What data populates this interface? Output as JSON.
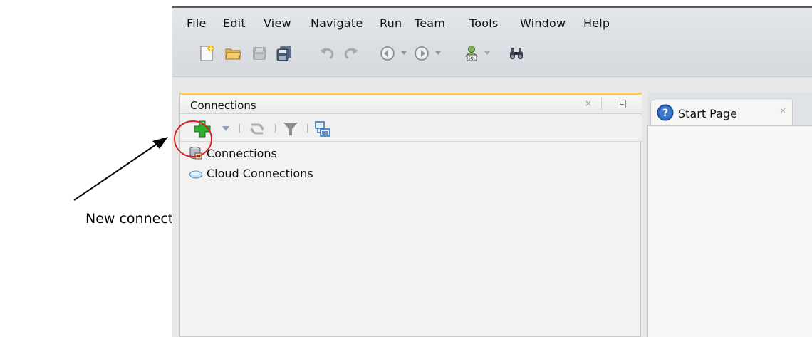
{
  "menubar": {
    "items": [
      {
        "pre": "",
        "u": "F",
        "post": "ile"
      },
      {
        "pre": "",
        "u": "E",
        "post": "dit"
      },
      {
        "pre": "",
        "u": "V",
        "post": "iew"
      },
      {
        "pre": "",
        "u": "N",
        "post": "avigate"
      },
      {
        "pre": "",
        "u": "R",
        "post": "un"
      },
      {
        "pre": "Tea",
        "u": "m",
        "post": ""
      },
      {
        "pre": "",
        "u": "T",
        "post": "ools"
      },
      {
        "pre": "",
        "u": "W",
        "post": "indow"
      },
      {
        "pre": "",
        "u": "H",
        "post": "elp"
      }
    ]
  },
  "toolbar": {
    "icons": [
      "new-file-icon",
      "open-folder-icon",
      "save-icon",
      "save-all-icon",
      "undo-icon",
      "redo-icon",
      "back-icon",
      "forward-icon",
      "sql-worksheet-icon",
      "binoculars-icon"
    ]
  },
  "connections_panel": {
    "title": "Connections",
    "close_glyph": "×",
    "toolbar_icons": [
      "new-connection-icon",
      "refresh-icon",
      "filter-icon",
      "schema-browser-icon"
    ],
    "tree": [
      {
        "label": "Connections",
        "icon": "database-connections-icon"
      },
      {
        "label": "Cloud Connections",
        "icon": "cloud-icon"
      }
    ]
  },
  "editor": {
    "tab_label": "Start Page",
    "tab_close_glyph": "×",
    "tab_icon": "help-icon"
  },
  "annotation": {
    "label": "New connection",
    "circle_color": "#d42020"
  }
}
